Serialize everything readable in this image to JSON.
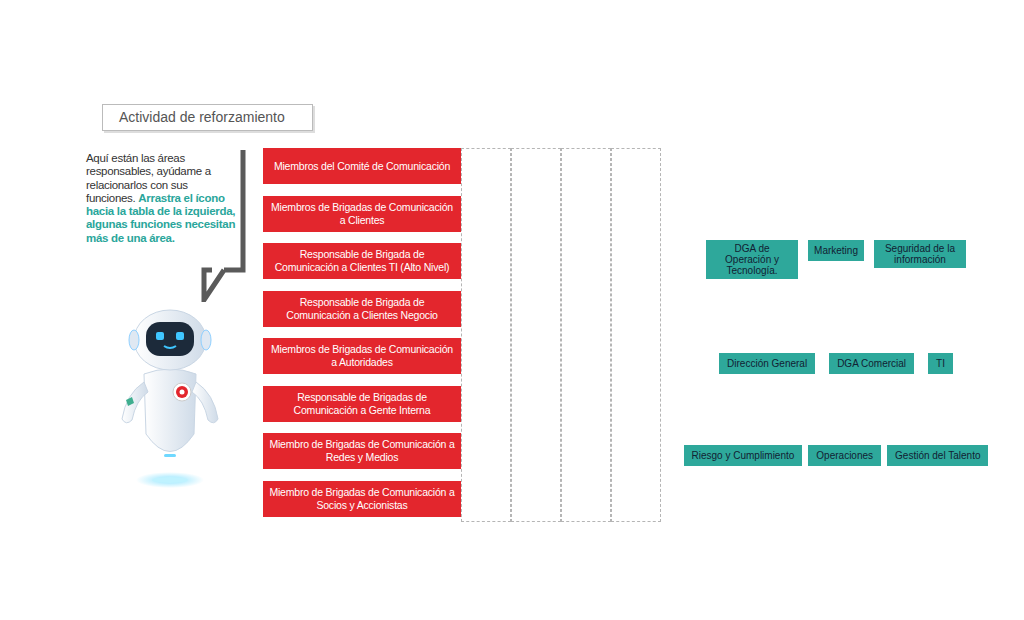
{
  "activity": {
    "title": "Actividad de reforzamiento"
  },
  "bubble": {
    "text": "Aquí están las áreas responsables, ayúdame a relacionarlos con sus funciones.",
    "highlight": "Arrastra el ícono hacia la tabla de la izquierda, algunas funciones necesitan más de una área."
  },
  "functions": [
    "Miembros del Comité de Comunicación",
    "Miembros de Brigadas de Comunicación a Clientes",
    "Responsable de Brigada de Comunicación a Clientes TI (Alto Nivel)",
    "Responsable de Brigada de Comunicación a Clientes Negocio",
    "Miembros de Brigadas de Comunicación a Autoridades",
    "Responsable de Brigadas de Comunicación a Gente Interna",
    "Miembro de Brigadas de Comunicación a Redes y Medios",
    "Miembro de Brigadas de Comunicación a Socios y Accionistas"
  ],
  "areas": [
    [
      "DGA de Operación y Tecnología.",
      "Marketing",
      "Seguridad de la información"
    ],
    [
      "Dirección General",
      "DGA Comercial",
      "TI"
    ],
    [
      "Riesgo y Cumplimiento",
      "Operaciones",
      "Gestión del Talento"
    ]
  ]
}
